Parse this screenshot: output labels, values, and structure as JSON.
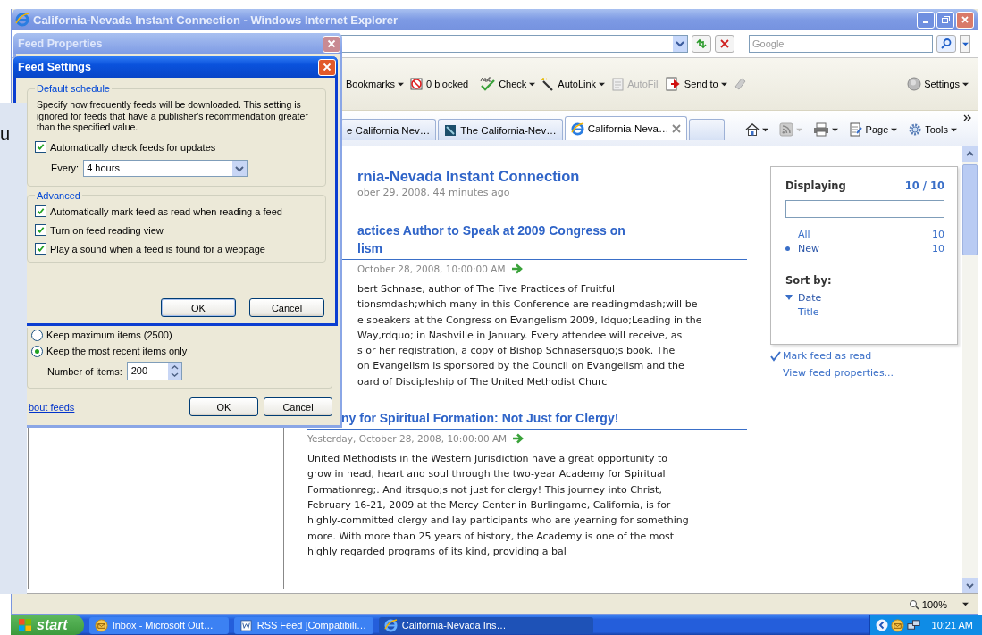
{
  "window": {
    "title": "California-Nevada Instant Connection - Windows Internet Explorer"
  },
  "search": {
    "placeholder": "Google"
  },
  "toolbar": [
    {
      "kind": "bookmarks",
      "label": "Bookmarks",
      "dropdown": true,
      "disabled": false
    },
    {
      "kind": "blocked",
      "label": "0 blocked",
      "dropdown": false,
      "disabled": false
    },
    {
      "kind": "check",
      "label": "Check",
      "dropdown": true,
      "disabled": false
    },
    {
      "kind": "autolink",
      "label": "AutoLink",
      "dropdown": true,
      "disabled": false
    },
    {
      "kind": "autofill",
      "label": "AutoFill",
      "dropdown": false,
      "disabled": true
    },
    {
      "kind": "sendto",
      "label": "Send to",
      "dropdown": true,
      "disabled": false
    },
    {
      "kind": "eraser",
      "dropdown": false,
      "disabled": true
    }
  ],
  "settings": {
    "label": "Settings"
  },
  "tabs": [
    {
      "kind": "page",
      "label": "e California Nev…",
      "selected": false
    },
    {
      "kind": "feed",
      "label": "The California-Nev…",
      "selected": false
    },
    {
      "kind": "ie",
      "label": "California-Neva…",
      "selected": true
    }
  ],
  "command_bar": [
    {
      "kind": "home",
      "disabled": false
    },
    {
      "kind": "feeds",
      "disabled": true
    },
    {
      "kind": "print",
      "disabled": false
    },
    {
      "kind": "page",
      "label": "Page",
      "disabled": false
    },
    {
      "kind": "tools",
      "label": "Tools",
      "disabled": false
    }
  ],
  "feed": {
    "title": "rnia-Nevada Instant Connection",
    "subtitle": "ober 29, 2008, 44 minutes ago",
    "items": [
      {
        "title_lines": [
          "actices Author to Speak at 2009 Congress on",
          "lism"
        ],
        "date": "October 28, 2008, 10:00:00 AM",
        "body_lines": [
          "bert Schnase, author of The Five Practices of Fruitful",
          "tionsmdash;which many in this Conference are readingmdash;will be",
          "e speakers at the Congress on Evangelism 2009, ldquo;Leading in the",
          "Way,rdquo; in Nashville in January. Every attendee will receive, as",
          "s or her registration, a copy of Bishop Schnasersquo;s book. The",
          "on Evangelism is sponsored by the Council on Evangelism and the",
          "oard of Discipleship of The United Methodist Churc"
        ]
      },
      {
        "title_lines": [
          "ny for Spiritual Formation: Not Just for Clergy!"
        ],
        "date": "Yesterday, October 28, 2008, 10:00:00 AM",
        "body_lines": [
          "United Methodists in the Western Jurisdiction have a great opportunity to",
          "grow in head, heart and soul through the two-year Academy for Spiritual",
          "Formationreg;. And itrsquo;s not just for clergy! This journey into Christ,",
          "February 16-21, 2009 at the Mercy Center in Burlingame, California, is for",
          "highly-committed clergy and lay participants who are yearning for something",
          "more. With more than 25 years of history, the Academy is one of the most",
          "highly regarded programs of its kind, providing a bal"
        ]
      }
    ]
  },
  "sidebar": {
    "heading": "Displaying",
    "count": "10 / 10",
    "filters": [
      {
        "label": "All",
        "count": "10",
        "selected": false
      },
      {
        "label": "New",
        "count": "10",
        "selected": true
      }
    ],
    "sort_heading": "Sort by:",
    "sort": [
      {
        "label": "Date",
        "selected": true
      },
      {
        "label": "Title",
        "selected": false
      }
    ],
    "links": [
      {
        "kind": "check",
        "label": "Mark feed as read"
      },
      {
        "kind": "plain",
        "label": "View feed properties..."
      }
    ]
  },
  "status_bar": {
    "zoom": "100%"
  },
  "feed_properties": {
    "title": "Feed Properties",
    "radios": [
      {
        "label": "Keep maximum items (2500)",
        "selected": false
      },
      {
        "label": "Keep the most recent items only",
        "selected": true
      }
    ],
    "number": {
      "label": "Number of items:",
      "value": "200"
    },
    "link": "bout feeds",
    "buttons": [
      "OK",
      "Cancel"
    ]
  },
  "feed_settings": {
    "title": "Feed Settings",
    "schedule": {
      "title": "Default schedule",
      "description": "Specify how frequently feeds will be downloaded. This setting is ignored for feeds that have a publisher's recommendation greater than the specified value.",
      "auto_check": {
        "label": "Automatically check feeds for updates",
        "checked": true
      },
      "every": {
        "label": "Every:",
        "value": "4 hours"
      }
    },
    "advanced": {
      "title": "Advanced",
      "options": [
        {
          "label": "Automatically mark feed as read when reading a feed",
          "checked": true
        },
        {
          "label": "Turn on feed reading view",
          "checked": true
        },
        {
          "label": "Play a sound when a feed is found for a webpage",
          "checked": true
        }
      ]
    },
    "buttons": [
      "OK",
      "Cancel"
    ]
  },
  "background_window": {
    "text": "u"
  },
  "taskbar": {
    "start": "start",
    "tasks": [
      {
        "kind": "mail",
        "label": "Inbox - Microsoft Out…",
        "selected": false
      },
      {
        "kind": "doc",
        "label": "RSS Feed [Compatibili…",
        "selected": false
      },
      {
        "kind": "ie",
        "label": "California-Nevada Ins…",
        "selected": true
      }
    ],
    "clock": "10:21 AM"
  }
}
